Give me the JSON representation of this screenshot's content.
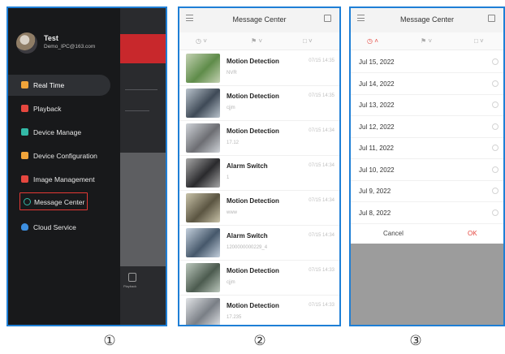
{
  "panel1": {
    "profile": {
      "username": "Test",
      "email": "Demo_IPC@163.com"
    },
    "menu": [
      {
        "label": "Real Time",
        "icon": "realtime-icon",
        "color": "#f0a43a",
        "active": true
      },
      {
        "label": "Playback",
        "icon": "playback-icon",
        "color": "#e5473f"
      },
      {
        "label": "Device Manage",
        "icon": "camera-icon",
        "color": "#33b9a7"
      },
      {
        "label": "Device Configuration",
        "icon": "config-icon",
        "color": "#f0a43a"
      },
      {
        "label": "Image Management",
        "icon": "image-icon",
        "color": "#e5473f"
      },
      {
        "label": "Message Center",
        "icon": "message-icon",
        "color": "#33b9a7",
        "highlighted": true
      },
      {
        "label": "Cloud Service",
        "icon": "cloud-icon",
        "color": "#3d8fe0"
      }
    ],
    "background_tab_label": "Playback"
  },
  "panel2": {
    "header": {
      "title": "Message Center"
    },
    "messages": [
      {
        "title": "Motion Detection",
        "source": "NVR",
        "time": "07/15 14:35",
        "thumb": [
          "#5f8c4a",
          "#c4d2b3"
        ]
      },
      {
        "title": "Motion Detection",
        "source": "cjjm",
        "time": "07/15 14:35",
        "thumb": [
          "#3f4a57",
          "#b9c3cc"
        ]
      },
      {
        "title": "Motion Detection",
        "source": "17.12",
        "time": "07/15 14:34",
        "thumb": [
          "#6d6e73",
          "#cfd3d8"
        ]
      },
      {
        "title": "Alarm Switch",
        "source": "1",
        "time": "07/15 14:34",
        "thumb": [
          "#2a2a2d",
          "#a7a7a7"
        ]
      },
      {
        "title": "Motion Detection",
        "source": "www",
        "time": "07/15 14:34",
        "thumb": [
          "#5b5542",
          "#c9c3a9"
        ]
      },
      {
        "title": "Alarm Switch",
        "source": "1200000000229_4",
        "time": "07/15 14:34",
        "thumb": [
          "#46586b",
          "#c3cfdc"
        ]
      },
      {
        "title": "Motion Detection",
        "source": "cjjm",
        "time": "07/15 14:33",
        "thumb": [
          "#4c5b4f",
          "#bcc8bd"
        ]
      },
      {
        "title": "Motion Detection",
        "source": "17.235",
        "time": "07/15 14:33",
        "thumb": [
          "#7a7f86",
          "#e1e3e6"
        ]
      }
    ]
  },
  "panel3": {
    "header": {
      "title": "Message Center"
    },
    "dates": [
      "Jul 15, 2022",
      "Jul 14, 2022",
      "Jul 13, 2022",
      "Jul 12, 2022",
      "Jul 11, 2022",
      "Jul 10, 2022",
      "Jul 9, 2022",
      "Jul 8, 2022"
    ],
    "cancel_label": "Cancel",
    "ok_label": "OK",
    "accent_color": "#e5473f"
  },
  "captions": [
    "①",
    "②",
    "③"
  ]
}
